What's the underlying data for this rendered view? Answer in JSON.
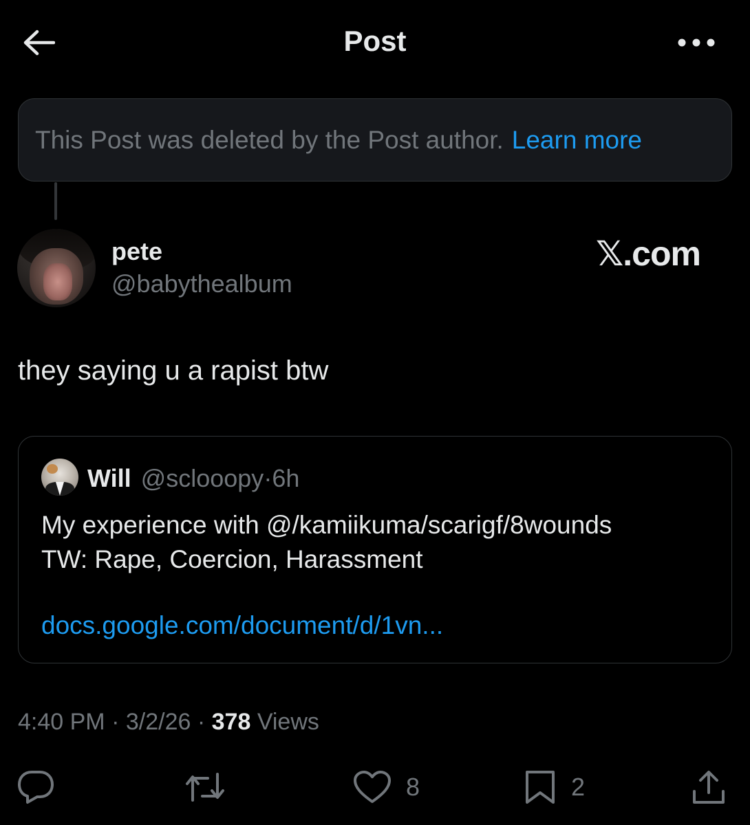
{
  "header": {
    "title": "Post",
    "back_icon": "arrow-left-icon",
    "more_icon": "more-horizontal-icon"
  },
  "deleted_notice": {
    "text": "This Post was deleted by the Post author.",
    "link": "Learn more"
  },
  "post": {
    "author": {
      "name": "pete",
      "handle": "@babythealbum"
    },
    "watermark": "𝕏.com",
    "text": "they saying u a rapist btw",
    "quote": {
      "name": "Will",
      "handle": "@sclooopy",
      "separator": "·",
      "time": "6h",
      "line1": "My experience with @/kamiikuma/scarigf/8wounds",
      "line2": "TW: Rape, Coercion, Harassment",
      "link": "docs.google.com/document/d/1vn..."
    },
    "meta": {
      "time": "4:40 PM",
      "sep1": "·",
      "date": "3/2/26",
      "sep2": "·",
      "views_count": "378",
      "views_label": "Views"
    },
    "actions": {
      "reply_count": "",
      "repost_count": "",
      "like_count": "8",
      "bookmark_count": "2"
    }
  },
  "colors": {
    "background": "#000000",
    "text_primary": "#e7e9ea",
    "text_secondary": "#71767b",
    "link": "#1d9bf0",
    "border": "#2f3336"
  }
}
